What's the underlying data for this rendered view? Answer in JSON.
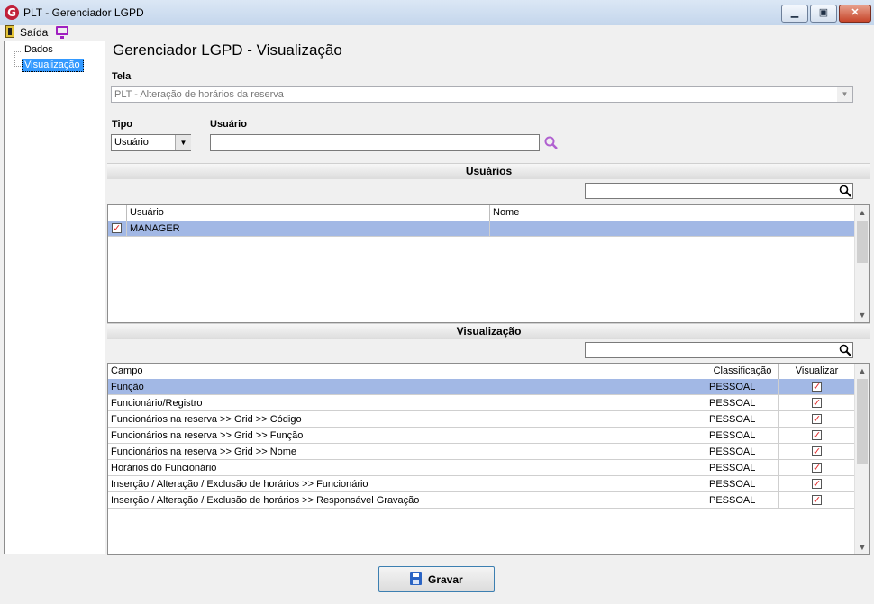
{
  "window": {
    "title": "PLT - Gerenciador LGPD",
    "logo": "G"
  },
  "menu": {
    "exit_label": "Saída"
  },
  "tree": {
    "items": [
      {
        "label": "Dados"
      },
      {
        "label": "Visualização"
      }
    ]
  },
  "page": {
    "title": "Gerenciador LGPD - Visualização"
  },
  "tela": {
    "label": "Tela",
    "value": "PLT - Alteração de horários da reserva"
  },
  "tipo": {
    "label": "Tipo",
    "value": "Usuário"
  },
  "usuario": {
    "label": "Usuário",
    "value": ""
  },
  "users_section": {
    "title": "Usuários",
    "filter_value": "",
    "columns": [
      "Usuário",
      "Nome"
    ],
    "rows": [
      {
        "checked": true,
        "usuario": "MANAGER",
        "nome": ""
      }
    ]
  },
  "view_section": {
    "title": "Visualização",
    "filter_value": "",
    "columns": [
      "Campo",
      "Classificação",
      "Visualizar"
    ],
    "rows": [
      {
        "campo": "Função",
        "classificacao": "PESSOAL",
        "visualizar": true
      },
      {
        "campo": "Funcionário/Registro",
        "classificacao": "PESSOAL",
        "visualizar": true
      },
      {
        "campo": "Funcionários na reserva >> Grid >> Código",
        "classificacao": "PESSOAL",
        "visualizar": true
      },
      {
        "campo": "Funcionários na reserva >> Grid >> Função",
        "classificacao": "PESSOAL",
        "visualizar": true
      },
      {
        "campo": "Funcionários na reserva >> Grid >> Nome",
        "classificacao": "PESSOAL",
        "visualizar": true
      },
      {
        "campo": "Horários do Funcionário",
        "classificacao": "PESSOAL",
        "visualizar": true
      },
      {
        "campo": "Inserção / Alteração / Exclusão de horários >> Funcionário",
        "classificacao": "PESSOAL",
        "visualizar": true
      },
      {
        "campo": "Inserção / Alteração / Exclusão de horários >> Responsável Gravação",
        "classificacao": "PESSOAL",
        "visualizar": true
      }
    ]
  },
  "actions": {
    "save_label": "Gravar"
  },
  "colors": {
    "selection": "#a2b8e5",
    "check": "#e02020",
    "search_icon": "#b060d0"
  }
}
